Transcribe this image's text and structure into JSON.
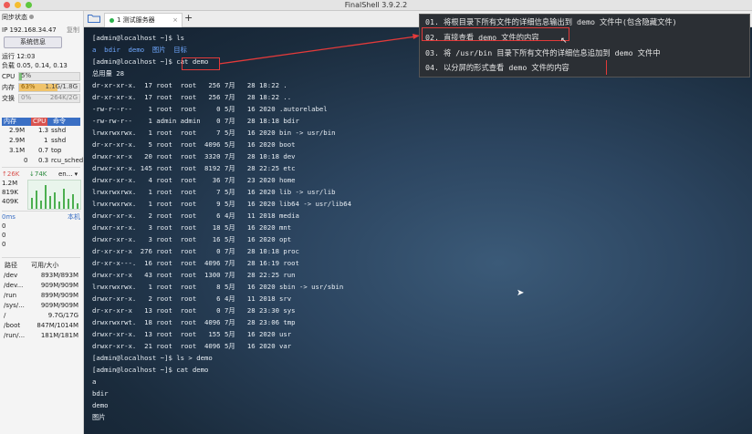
{
  "window": {
    "title": "FinalShell 3.9.2.2"
  },
  "sidebar": {
    "sync_label": "同步状态",
    "ip": "IP 192.168.34.47",
    "copy": "复制",
    "sysinfo_button": "系统信息",
    "uptime": "运行 12:03",
    "load": "负载 0.05, 0.14, 0.13",
    "cpu_label": "CPU",
    "cpu_value": "5%",
    "mem_label": "内存",
    "mem_pct": "63%",
    "mem_value": "1.1G/1.8G",
    "swap_label": "交换",
    "swap_pct": "0%",
    "swap_value": "264K/2G",
    "proc_headers": [
      "内存",
      "CPU",
      "命令"
    ],
    "procs": [
      {
        "mem": "2.9M",
        "cpu": "1.3",
        "cmd": "sshd"
      },
      {
        "mem": "2.9M",
        "cpu": "1",
        "cmd": "sshd"
      },
      {
        "mem": "3.1M",
        "cpu": "0.7",
        "cmd": "top"
      },
      {
        "mem": "0",
        "cpu": "0.3",
        "cmd": "rcu_sched"
      }
    ],
    "net_up": "↑26K",
    "net_down": "↓74K",
    "net_iface": "en...",
    "net_scale": [
      "1.2M",
      "819K",
      "409K"
    ],
    "latency_label": "0ms",
    "latency_host": "本机",
    "latency_vals": [
      "0",
      "0",
      "0"
    ],
    "disk_headers": [
      "路径",
      "可用/大小"
    ],
    "disks": [
      {
        "path": "/dev",
        "size": "893M/893M"
      },
      {
        "path": "/dev...",
        "size": "909M/909M"
      },
      {
        "path": "/run",
        "size": "899M/909M"
      },
      {
        "path": "/sys/...",
        "size": "909M/909M"
      },
      {
        "path": "/",
        "size": "9.7G/17G"
      },
      {
        "path": "/boot",
        "size": "847M/1014M"
      },
      {
        "path": "/run/...",
        "size": "181M/181M"
      }
    ]
  },
  "tabs": [
    {
      "label": "1 测试服务器"
    }
  ],
  "terminal": {
    "lines": [
      "[admin@localhost ~]$ ls",
      "a  bdir  demo  图片  目标",
      "[admin@localhost ~]$ cat demo",
      "总用量 28",
      "dr-xr-xr-x.  17 root  root   256 7月   28 18:22 .",
      "dr-xr-xr-x.  17 root  root   256 7月   28 18:22 ..",
      "-rw-r--r--    1 root  root     0 5月   16 2020 .autorelabel",
      "-rw-rw-r--    1 admin admin    0 7月   28 18:18 bdir",
      "lrwxrwxrwx.   1 root  root     7 5月   16 2020 bin -> usr/bin",
      "dr-xr-xr-x.   5 root  root  4096 5月   16 2020 boot",
      "drwxr-xr-x   20 root  root  3320 7月   28 10:18 dev",
      "drwxr-xr-x. 145 root  root  8192 7月   28 22:25 etc",
      "drwxr-xr-x.   4 root  root    36 7月   23 2020 home",
      "lrwxrwxrwx.   1 root  root     7 5月   16 2020 lib -> usr/lib",
      "lrwxrwxrwx.   1 root  root     9 5月   16 2020 lib64 -> usr/lib64",
      "drwxr-xr-x.   2 root  root     6 4月   11 2018 media",
      "drwxr-xr-x.   3 root  root    18 5月   16 2020 mnt",
      "drwxr-xr-x.   3 root  root    16 5月   16 2020 opt",
      "dr-xr-xr-x  276 root  root     0 7月   28 10:18 proc",
      "dr-xr-x---.  16 root  root  4096 7月   28 16:19 root",
      "drwxr-xr-x   43 root  root  1300 7月   28 22:25 run",
      "lrwxrwxrwx.   1 root  root     8 5月   16 2020 sbin -> usr/sbin",
      "drwxr-xr-x.   2 root  root     6 4月   11 2018 srv",
      "dr-xr-xr-x   13 root  root     0 7月   28 23:30 sys",
      "drwxrwxrwt.  18 root  root  4096 7月   28 23:06 tmp",
      "drwxr-xr-x.  13 root  root   155 5月   16 2020 usr",
      "drwxr-xr-x.  21 root  root  4096 5月   16 2020 var",
      "[admin@localhost ~]$ ls > demo",
      "[admin@localhost ~]$ cat demo",
      "a",
      "bdir",
      "demo",
      "图片"
    ]
  },
  "notes": [
    "01. 将根目录下所有文件的详细信息输出到 demo 文件中(包含隐藏文件)",
    "02. 直接查看 demo 文件的内容",
    "03. 将 /usr/bin 目录下所有文件的详细信息追加到 demo 文件中",
    "04. 以分屏的形式查看 demo 文件的内容"
  ],
  "colors": {
    "accent": "#3a6fc4",
    "annotation": "#e23a3a",
    "online": "#2bb24c"
  }
}
